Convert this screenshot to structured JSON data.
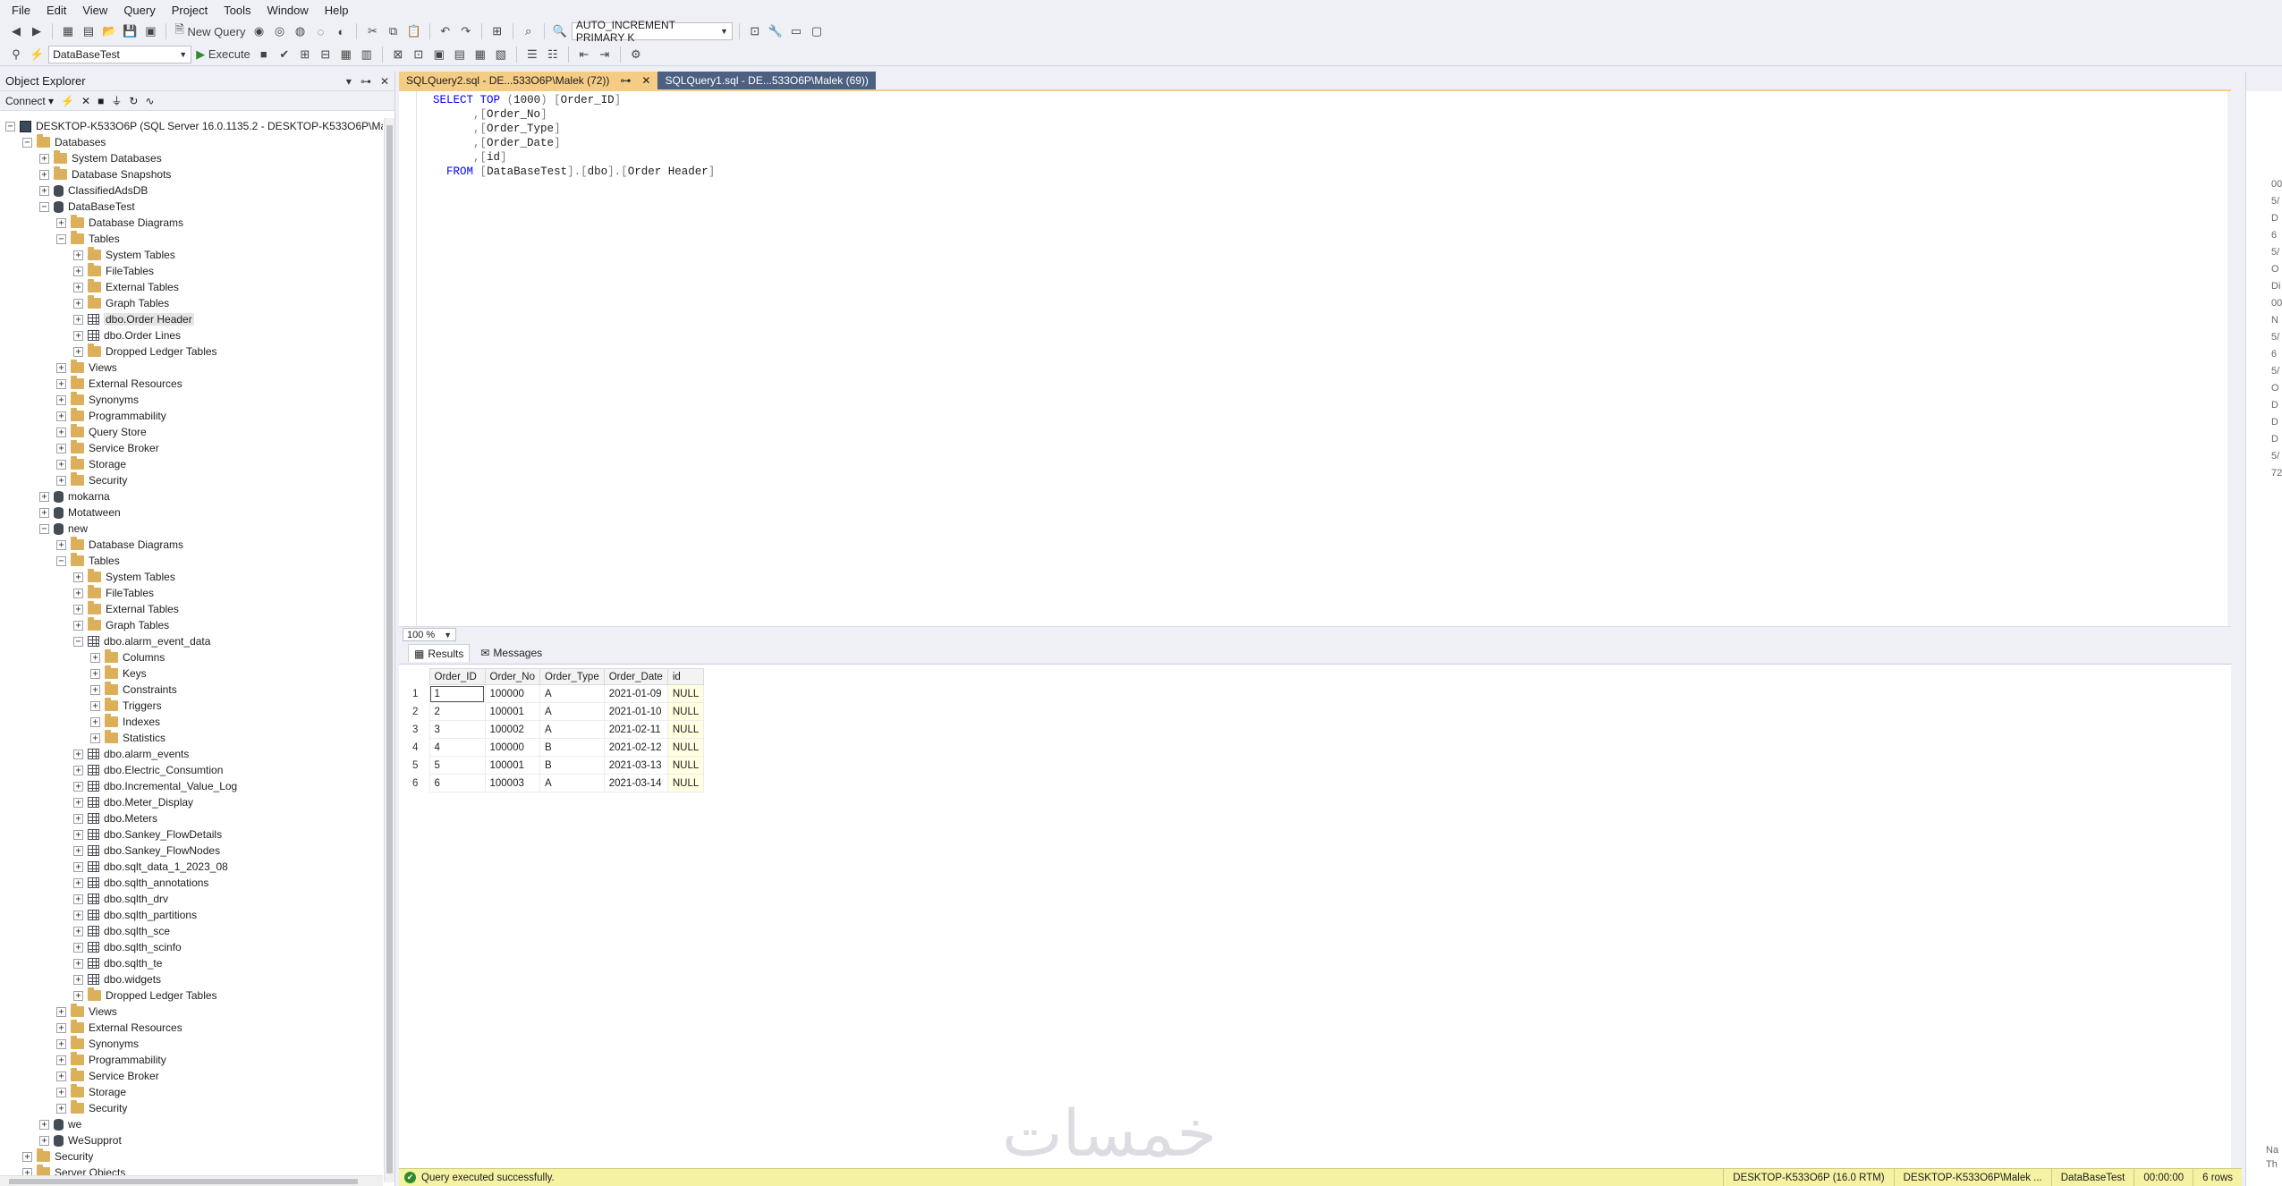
{
  "menu": [
    "File",
    "Edit",
    "View",
    "Query",
    "Project",
    "Tools",
    "Window",
    "Help"
  ],
  "toolbar": {
    "new_query": "New Query",
    "target_combo": "AUTO_INCREMENT PRIMARY K",
    "db_combo": "DataBaseTest",
    "execute": "Execute"
  },
  "object_explorer": {
    "title": "Object Explorer",
    "connect": "Connect"
  },
  "tree": [
    {
      "level": 0,
      "exp": "-",
      "icon": "server",
      "label": "DESKTOP-K533O6P (SQL Server 16.0.1135.2 - DESKTOP-K533O6P\\Malek)"
    },
    {
      "level": 1,
      "exp": "-",
      "icon": "folder",
      "label": "Databases"
    },
    {
      "level": 2,
      "exp": "+",
      "icon": "folder",
      "label": "System Databases"
    },
    {
      "level": 2,
      "exp": "+",
      "icon": "folder",
      "label": "Database Snapshots"
    },
    {
      "level": 2,
      "exp": "+",
      "icon": "db",
      "label": "ClassifiedAdsDB"
    },
    {
      "level": 2,
      "exp": "-",
      "icon": "db",
      "label": "DataBaseTest"
    },
    {
      "level": 3,
      "exp": "+",
      "icon": "folder",
      "label": "Database Diagrams"
    },
    {
      "level": 3,
      "exp": "-",
      "icon": "folder",
      "label": "Tables"
    },
    {
      "level": 4,
      "exp": "+",
      "icon": "folder",
      "label": "System Tables"
    },
    {
      "level": 4,
      "exp": "+",
      "icon": "folder",
      "label": "FileTables"
    },
    {
      "level": 4,
      "exp": "+",
      "icon": "folder",
      "label": "External Tables"
    },
    {
      "level": 4,
      "exp": "+",
      "icon": "folder",
      "label": "Graph Tables"
    },
    {
      "level": 4,
      "exp": "+",
      "icon": "table",
      "label": "dbo.Order Header",
      "selected": true
    },
    {
      "level": 4,
      "exp": "+",
      "icon": "table",
      "label": "dbo.Order Lines"
    },
    {
      "level": 4,
      "exp": "+",
      "icon": "folder",
      "label": "Dropped Ledger Tables"
    },
    {
      "level": 3,
      "exp": "+",
      "icon": "folder",
      "label": "Views"
    },
    {
      "level": 3,
      "exp": "+",
      "icon": "folder",
      "label": "External Resources"
    },
    {
      "level": 3,
      "exp": "+",
      "icon": "folder",
      "label": "Synonyms"
    },
    {
      "level": 3,
      "exp": "+",
      "icon": "folder",
      "label": "Programmability"
    },
    {
      "level": 3,
      "exp": "+",
      "icon": "folder",
      "label": "Query Store"
    },
    {
      "level": 3,
      "exp": "+",
      "icon": "folder",
      "label": "Service Broker"
    },
    {
      "level": 3,
      "exp": "+",
      "icon": "folder",
      "label": "Storage"
    },
    {
      "level": 3,
      "exp": "+",
      "icon": "folder",
      "label": "Security"
    },
    {
      "level": 2,
      "exp": "+",
      "icon": "db",
      "label": "mokarna"
    },
    {
      "level": 2,
      "exp": "+",
      "icon": "db",
      "label": "Motatween"
    },
    {
      "level": 2,
      "exp": "-",
      "icon": "db",
      "label": "new"
    },
    {
      "level": 3,
      "exp": "+",
      "icon": "folder",
      "label": "Database Diagrams"
    },
    {
      "level": 3,
      "exp": "-",
      "icon": "folder",
      "label": "Tables"
    },
    {
      "level": 4,
      "exp": "+",
      "icon": "folder",
      "label": "System Tables"
    },
    {
      "level": 4,
      "exp": "+",
      "icon": "folder",
      "label": "FileTables"
    },
    {
      "level": 4,
      "exp": "+",
      "icon": "folder",
      "label": "External Tables"
    },
    {
      "level": 4,
      "exp": "+",
      "icon": "folder",
      "label": "Graph Tables"
    },
    {
      "level": 4,
      "exp": "-",
      "icon": "table",
      "label": "dbo.alarm_event_data"
    },
    {
      "level": 5,
      "exp": "+",
      "icon": "folder",
      "label": "Columns"
    },
    {
      "level": 5,
      "exp": "+",
      "icon": "folder",
      "label": "Keys"
    },
    {
      "level": 5,
      "exp": "+",
      "icon": "folder",
      "label": "Constraints"
    },
    {
      "level": 5,
      "exp": "+",
      "icon": "folder",
      "label": "Triggers"
    },
    {
      "level": 5,
      "exp": "+",
      "icon": "folder",
      "label": "Indexes"
    },
    {
      "level": 5,
      "exp": "+",
      "icon": "folder",
      "label": "Statistics"
    },
    {
      "level": 4,
      "exp": "+",
      "icon": "table",
      "label": "dbo.alarm_events"
    },
    {
      "level": 4,
      "exp": "+",
      "icon": "table",
      "label": "dbo.Electric_Consumtion"
    },
    {
      "level": 4,
      "exp": "+",
      "icon": "table",
      "label": "dbo.Incremental_Value_Log"
    },
    {
      "level": 4,
      "exp": "+",
      "icon": "table",
      "label": "dbo.Meter_Display"
    },
    {
      "level": 4,
      "exp": "+",
      "icon": "table",
      "label": "dbo.Meters"
    },
    {
      "level": 4,
      "exp": "+",
      "icon": "table",
      "label": "dbo.Sankey_FlowDetails"
    },
    {
      "level": 4,
      "exp": "+",
      "icon": "table",
      "label": "dbo.Sankey_FlowNodes"
    },
    {
      "level": 4,
      "exp": "+",
      "icon": "table",
      "label": "dbo.sqlt_data_1_2023_08"
    },
    {
      "level": 4,
      "exp": "+",
      "icon": "table",
      "label": "dbo.sqlth_annotations"
    },
    {
      "level": 4,
      "exp": "+",
      "icon": "table",
      "label": "dbo.sqlth_drv"
    },
    {
      "level": 4,
      "exp": "+",
      "icon": "table",
      "label": "dbo.sqlth_partitions"
    },
    {
      "level": 4,
      "exp": "+",
      "icon": "table",
      "label": "dbo.sqlth_sce"
    },
    {
      "level": 4,
      "exp": "+",
      "icon": "table",
      "label": "dbo.sqlth_scinfo"
    },
    {
      "level": 4,
      "exp": "+",
      "icon": "table",
      "label": "dbo.sqlth_te"
    },
    {
      "level": 4,
      "exp": "+",
      "icon": "table",
      "label": "dbo.widgets"
    },
    {
      "level": 4,
      "exp": "+",
      "icon": "folder",
      "label": "Dropped Ledger Tables"
    },
    {
      "level": 3,
      "exp": "+",
      "icon": "folder",
      "label": "Views"
    },
    {
      "level": 3,
      "exp": "+",
      "icon": "folder",
      "label": "External Resources"
    },
    {
      "level": 3,
      "exp": "+",
      "icon": "folder",
      "label": "Synonyms"
    },
    {
      "level": 3,
      "exp": "+",
      "icon": "folder",
      "label": "Programmability"
    },
    {
      "level": 3,
      "exp": "+",
      "icon": "folder",
      "label": "Service Broker"
    },
    {
      "level": 3,
      "exp": "+",
      "icon": "folder",
      "label": "Storage"
    },
    {
      "level": 3,
      "exp": "+",
      "icon": "folder",
      "label": "Security"
    },
    {
      "level": 2,
      "exp": "+",
      "icon": "db",
      "label": "we"
    },
    {
      "level": 2,
      "exp": "+",
      "icon": "db",
      "label": "WeSupprot"
    },
    {
      "level": 1,
      "exp": "+",
      "icon": "folder",
      "label": "Security"
    },
    {
      "level": 1,
      "exp": "+",
      "icon": "folder",
      "label": "Server Objects"
    }
  ],
  "tabs": [
    {
      "label": "SQLQuery2.sql - DE...533O6P\\Malek (72))",
      "active": true,
      "pin": "⊶",
      "close": "✕"
    },
    {
      "label": "SQLQuery1.sql - DE...533O6P\\Malek (69))",
      "active": false,
      "pin": "",
      "close": ""
    }
  ],
  "editor": {
    "lines": [
      "SELECT TOP (1000) [Order_ID]",
      "      ,[Order_No]",
      "      ,[Order_Type]",
      "      ,[Order_Date]",
      "      ,[id]",
      "  FROM [DataBaseTest].[dbo].[Order Header]"
    ],
    "zoom": "100 %"
  },
  "results": {
    "tab_results": "Results",
    "tab_messages": "Messages",
    "columns": [
      "Order_ID",
      "Order_No",
      "Order_Type",
      "Order_Date",
      "id"
    ],
    "rows": [
      [
        "1",
        "1",
        "100000",
        "A",
        "2021-01-09",
        "NULL"
      ],
      [
        "2",
        "2",
        "100001",
        "A",
        "2021-01-10",
        "NULL"
      ],
      [
        "3",
        "3",
        "100002",
        "A",
        "2021-02-11",
        "NULL"
      ],
      [
        "4",
        "4",
        "100000",
        "B",
        "2021-02-12",
        "NULL"
      ],
      [
        "5",
        "5",
        "100001",
        "B",
        "2021-03-13",
        "NULL"
      ],
      [
        "6",
        "6",
        "100003",
        "A",
        "2021-03-14",
        "NULL"
      ]
    ]
  },
  "status": {
    "message": "Query executed successfully.",
    "server": "DESKTOP-K533O6P (16.0 RTM)",
    "user": "DESKTOP-K533O6P\\Malek ...",
    "database": "DataBaseTest",
    "time": "00:00:00",
    "rows": "6 rows"
  },
  "watermark": "خمسات",
  "right_panel_lines": [
    "00",
    "5/",
    "D",
    "6",
    "5/",
    "O",
    "Di",
    "00",
    "N",
    "5/",
    "6",
    "5/",
    "O",
    "D",
    "D",
    "D",
    "5/",
    "72"
  ],
  "right_panel_footer": [
    "Na",
    "Th"
  ]
}
